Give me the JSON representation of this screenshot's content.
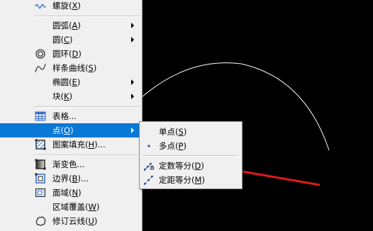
{
  "colors": {
    "highlight": "#0a78d7",
    "menu_bg": "#f0f0f0",
    "canvas_bg": "#000000",
    "arrow": "#e1191d"
  },
  "menu": {
    "items": [
      {
        "label": "螺旋(X)",
        "icon": "helix-icon"
      },
      {
        "label": "圆弧(A)",
        "icon": "",
        "submenu": true
      },
      {
        "label": "圆(C)",
        "icon": "",
        "submenu": true
      },
      {
        "label": "圆环(D)",
        "icon": "donut-icon"
      },
      {
        "label": "样条曲线(S)",
        "icon": "spline-icon"
      },
      {
        "label": "椭圆(E)",
        "icon": "",
        "submenu": true
      },
      {
        "label": "块(K)",
        "icon": "",
        "submenu": true
      },
      {
        "label": "表格...",
        "icon": "table-icon"
      },
      {
        "label": "点(O)",
        "icon": "",
        "submenu": true,
        "highlighted": true
      },
      {
        "label": "图案填充(H)...",
        "icon": "hatch-icon"
      },
      {
        "label": "渐变色...",
        "icon": "gradient-icon"
      },
      {
        "label": "边界(B)...",
        "icon": "boundary-icon"
      },
      {
        "label": "面域(N)",
        "icon": "region-icon"
      },
      {
        "label": "区域覆盖(W)",
        "icon": ""
      },
      {
        "label": "修订云线(U)",
        "icon": "revcloud-icon"
      }
    ]
  },
  "point_submenu": {
    "items": [
      {
        "label": "单点(S)",
        "icon": ""
      },
      {
        "label": "多点(P)",
        "icon": "multiple-points-icon"
      },
      {
        "label": "定数等分(D)",
        "icon": "divide-icon"
      },
      {
        "label": "定距等分(M)",
        "icon": "measure-icon"
      }
    ]
  }
}
